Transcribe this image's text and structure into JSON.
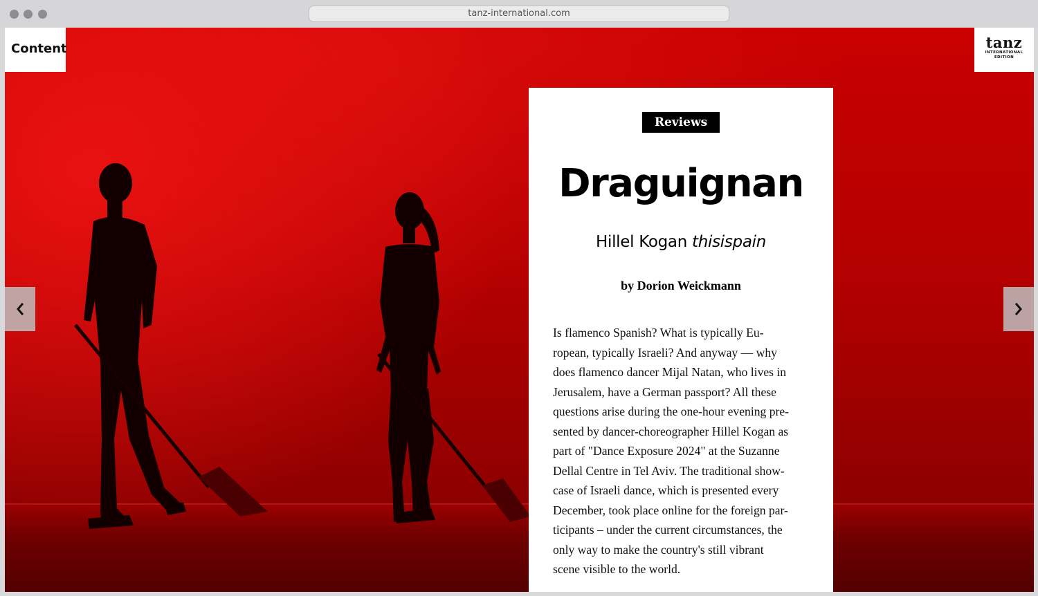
{
  "browser": {
    "url": "tanz-international.com"
  },
  "nav": {
    "content_label": "Content"
  },
  "logo": {
    "wordmark": "tanz",
    "line1": "INTERNATIONAL",
    "line2": "EDITION"
  },
  "article": {
    "category": "Reviews",
    "title": "Draguignan",
    "subtitle_name": "Hillel Kogan",
    "subtitle_work": "thisispain",
    "byline": "by Dorion Weickmann",
    "body_lines": [
      "Is flamenco Spanish? What is typically Eu-",
      "ropean, typically Israeli? And anyway — why",
      "does flamenco dancer Mijal Natan, who lives in",
      "Jerusalem, have a German passport? All these",
      "questions arise during the one-hour evening pre-",
      "sented by dancer-choreographer Hillel Kogan as",
      "part of \"Dance Exposure 2024\" at the Suzanne",
      "Dellal Centre in Tel Aviv. The traditional show-",
      "case of Israeli dance, which is presented every",
      "December, took place online for the foreign par-",
      "ticipants – under the current circumstances, the",
      "only way to make the country's still vibrant",
      "scene visible to the world."
    ]
  },
  "icons": {
    "prev": "chevron-left-icon",
    "next": "chevron-right-icon"
  },
  "colors": {
    "stage_red": "#c90000",
    "card_bg": "#ffffff",
    "tag_bg": "#000000"
  }
}
